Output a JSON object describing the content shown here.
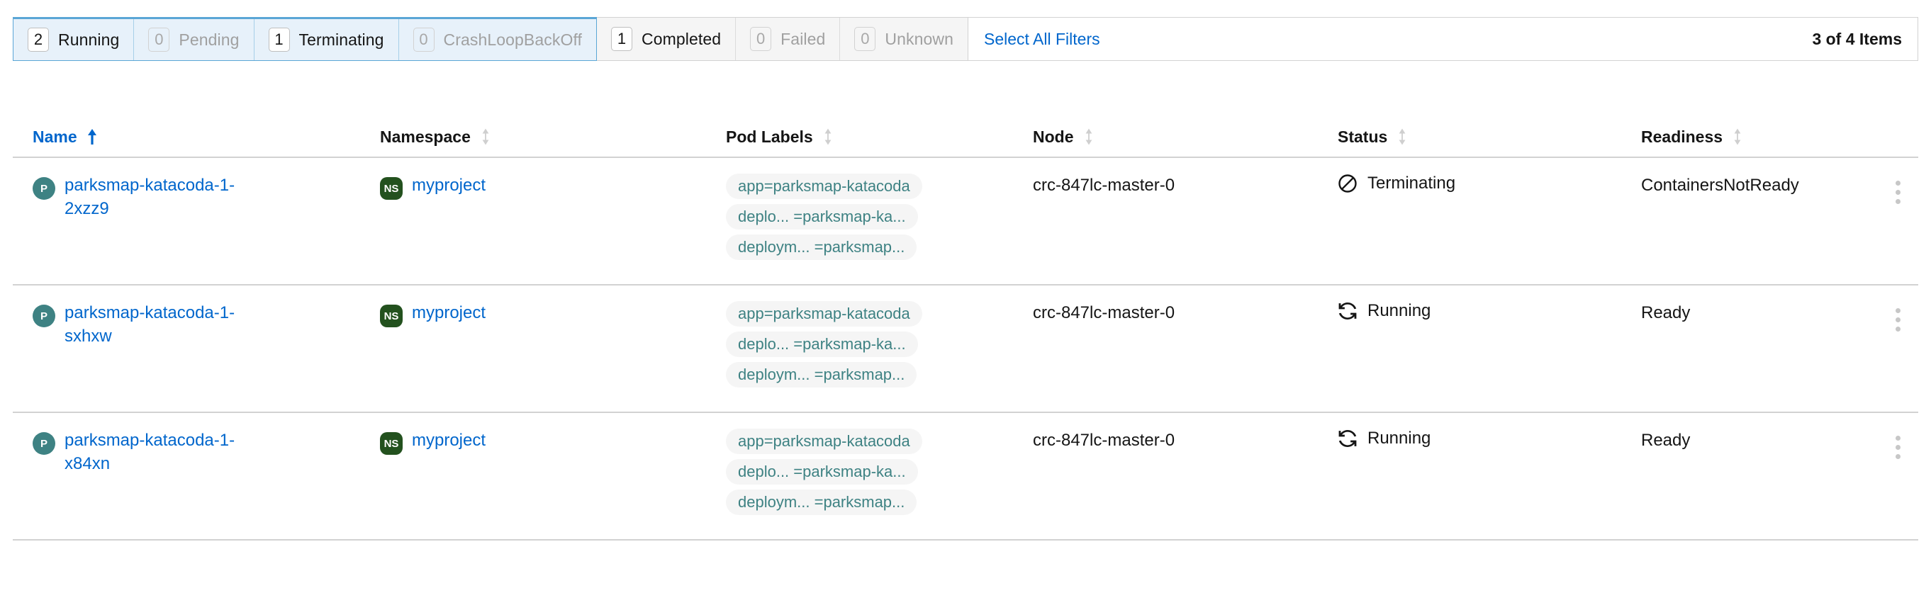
{
  "filter_toolbar": {
    "groups": [
      {
        "selected": true,
        "chips": [
          {
            "count": "2",
            "label": "Running",
            "active": true
          },
          {
            "count": "0",
            "label": "Pending",
            "active": false
          },
          {
            "count": "1",
            "label": "Terminating",
            "active": true
          },
          {
            "count": "0",
            "label": "CrashLoopBackOff",
            "active": false
          }
        ]
      },
      {
        "selected": false,
        "chips": [
          {
            "count": "1",
            "label": "Completed",
            "active": true
          },
          {
            "count": "0",
            "label": "Failed",
            "active": false
          },
          {
            "count": "0",
            "label": "Unknown",
            "active": false
          }
        ]
      }
    ],
    "select_all_filters": "Select All Filters",
    "items_count": "3 of 4 Items"
  },
  "table": {
    "columns": [
      {
        "label": "Name",
        "sort": "asc",
        "active": true,
        "icon": "sort-ascending-icon"
      },
      {
        "label": "Namespace",
        "sort": "none",
        "active": false,
        "icon": "sort-icon"
      },
      {
        "label": "Pod Labels",
        "sort": "none",
        "active": false,
        "icon": "sort-icon"
      },
      {
        "label": "Node",
        "sort": "none",
        "active": false,
        "icon": "sort-icon"
      },
      {
        "label": "Status",
        "sort": "none",
        "active": false,
        "icon": "sort-icon"
      },
      {
        "label": "Readiness",
        "sort": "none",
        "active": false,
        "icon": "sort-icon"
      }
    ],
    "rows": [
      {
        "name": "parksmap-katacoda-1-2xzz9",
        "name_badge": "P",
        "namespace": "myproject",
        "namespace_badge": "NS",
        "labels": [
          "app=parksmap-katacoda",
          "deplo...  =parksmap-ka...",
          "deploym...  =parksmap..."
        ],
        "node": "crc-847lc-master-0",
        "status": "Terminating",
        "status_icon": "ban-icon",
        "readiness": "ContainersNotReady",
        "kebab": "kebab-menu-icon"
      },
      {
        "name": "parksmap-katacoda-1-sxhxw",
        "name_badge": "P",
        "namespace": "myproject",
        "namespace_badge": "NS",
        "labels": [
          "app=parksmap-katacoda",
          "deplo...  =parksmap-ka...",
          "deploym...  =parksmap..."
        ],
        "node": "crc-847lc-master-0",
        "status": "Running",
        "status_icon": "sync-icon",
        "readiness": "Ready",
        "kebab": "kebab-menu-icon"
      },
      {
        "name": "parksmap-katacoda-1-x84xn",
        "name_badge": "P",
        "namespace": "myproject",
        "namespace_badge": "NS",
        "labels": [
          "app=parksmap-katacoda",
          "deplo...  =parksmap-ka...",
          "deploym...  =parksmap..."
        ],
        "node": "crc-847lc-master-0",
        "status": "Running",
        "status_icon": "sync-icon",
        "readiness": "Ready",
        "kebab": "kebab-menu-icon"
      }
    ]
  },
  "colors": {
    "link": "#0066cc",
    "selected_filter_bg": "#e7f1fa",
    "selected_filter_border": "#5aa6d6",
    "unselected_filter_bg": "#f5f5f5",
    "pod_badge": "#3e8283",
    "namespace_badge": "#23511e",
    "label_chip_text": "#3e8283"
  }
}
